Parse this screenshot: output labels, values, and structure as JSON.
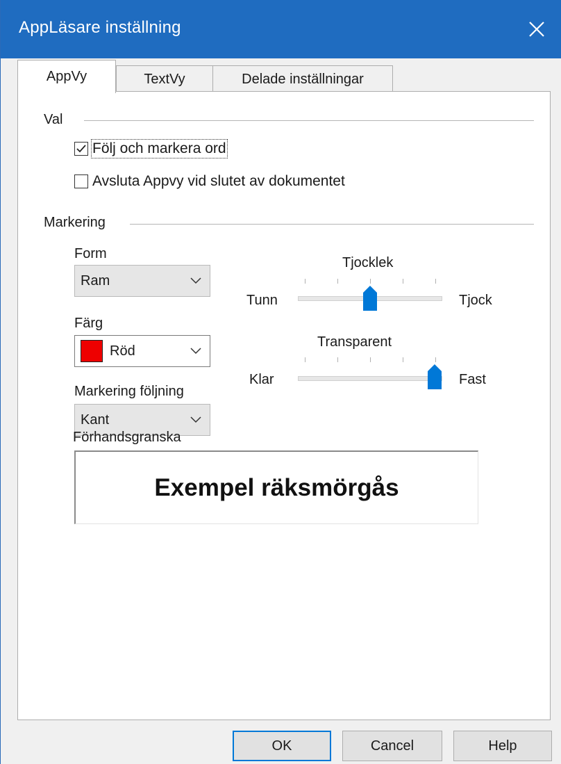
{
  "window": {
    "title": "AppLäsare inställning",
    "close_icon": "close-icon",
    "title_color": "#1f6cc0"
  },
  "tabs": [
    {
      "label": "AppVy",
      "active": true
    },
    {
      "label": "TextVy",
      "active": false
    },
    {
      "label": "Delade inställningar",
      "active": false
    }
  ],
  "val_group": {
    "label": "Val",
    "options": [
      {
        "label": "Följ och markera ord",
        "checked": true
      },
      {
        "label": "Avsluta Appvy vid slutet av dokumentet",
        "checked": false
      }
    ]
  },
  "markering_group": {
    "label": "Markering",
    "form": {
      "label": "Form",
      "value": "Ram"
    },
    "farg": {
      "label": "Färg",
      "value": "Röd",
      "swatch_color": "#ee0000"
    },
    "foljning": {
      "label": "Markering följning",
      "value": "Kant"
    },
    "tjocklek": {
      "title": "Tjocklek",
      "min_label": "Tunn",
      "max_label": "Tjock",
      "position_fraction": 0.5
    },
    "transparent": {
      "title": "Transparent",
      "min_label": "Klar",
      "max_label": "Fast",
      "position_fraction": 1.0
    },
    "preview": {
      "label": "Förhandsgranska",
      "text": "Exempel räksmörgås"
    }
  },
  "buttons": {
    "ok": "OK",
    "cancel": "Cancel",
    "help": "Help"
  },
  "accent_color": "#0078d7"
}
